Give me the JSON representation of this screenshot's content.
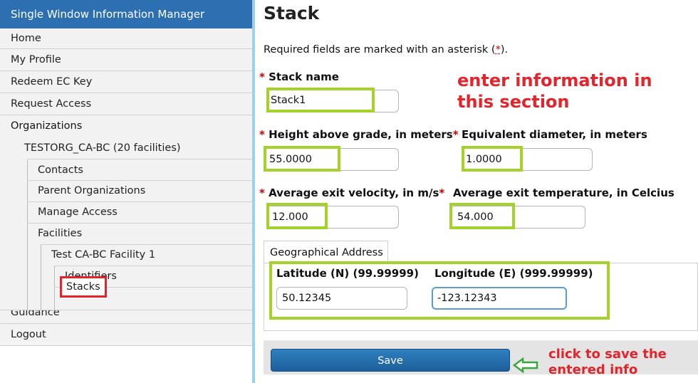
{
  "sidebar": {
    "header": "Single Window Information Manager",
    "items": {
      "home": "Home",
      "my_profile": "My Profile",
      "redeem": "Redeem EC Key",
      "request_access": "Request Access",
      "organizations": "Organizations",
      "org_name": "TESTORG_CA-BC (20 facilities)",
      "contacts": "Contacts",
      "parent_orgs": "Parent Organizations",
      "manage_access": "Manage Access",
      "facilities": "Facilities",
      "facility_name": "Test CA-BC Facility 1",
      "identifiers": "Identifiers",
      "stacks": "Stacks",
      "guidance": "Guidance",
      "logout": "Logout"
    }
  },
  "main": {
    "title": "Stack",
    "required_note_prefix": "Required fields are marked with an asterisk (",
    "required_star": "*",
    "required_note_suffix": ").",
    "asterisk": "*",
    "fields": {
      "stack_name_label": "Stack name",
      "stack_name_value": "Stack1",
      "height_label": "Height above grade, in meters",
      "height_value": "55.0000",
      "diameter_label": "Equivalent diameter, in meters",
      "diameter_value": "1.0000",
      "velocity_label": "Average exit velocity, in m/s",
      "velocity_value": "12.000",
      "temperature_label": "Average exit temperature, in Celcius",
      "temperature_value": "54.000"
    },
    "geo": {
      "tab": "Geographical Address",
      "lat_label": "Latitude (N) (99.99999)",
      "lat_value": "50.12345",
      "lon_label": "Longitude (E) (999.99999)",
      "lon_value": "-123.12343"
    },
    "save_label": "Save",
    "annotations": {
      "enter_line1": "enter information in",
      "enter_line2": "this section",
      "save_line1": "click to save the",
      "save_line2": "entered info"
    }
  },
  "colors": {
    "header_blue": "#2c70b1",
    "highlight_green": "#a5d228",
    "annotation_red": "#e5232b",
    "save_blue": "#1d5f99"
  }
}
